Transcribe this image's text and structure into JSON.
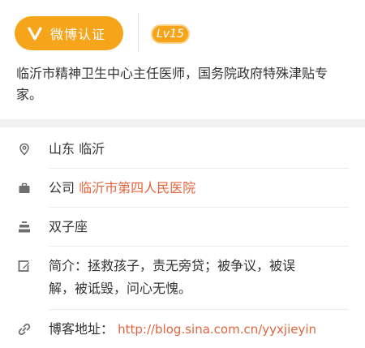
{
  "header": {
    "verified_label": "微博认证",
    "level_label": "Lv15",
    "bio": "临沂市精神卫生中心主任医师，国务院政府特殊津贴专家。"
  },
  "info": {
    "location": "山东 临沂",
    "company_prefix": "公司",
    "company_name": "临沂市第四人民医院",
    "zodiac": "双子座",
    "intro_label": "简介：",
    "intro_text": "拯救孩子，责无旁贷；被争议，被误解，被诋毁，问心无愧。",
    "intro_line1": "拯救孩子，责无旁贷；被争议，被误",
    "intro_line2": "解，被诋毁，问心无愧。",
    "blog_label": "博客地址：",
    "blog_url": "http://blog.sina.com.cn/yyxjieyin"
  },
  "colors": {
    "accent": "#f6a51b",
    "link": "#e0653e",
    "text": "#333333",
    "icon": "#6f6f6f"
  },
  "icons": [
    "verified-v-icon",
    "location-pin-icon",
    "briefcase-icon",
    "cake-icon",
    "edit-icon",
    "link-icon"
  ]
}
